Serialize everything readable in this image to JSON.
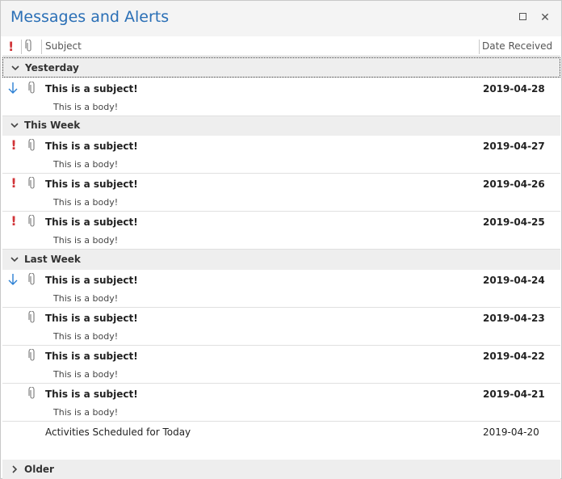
{
  "window": {
    "title": "Messages and Alerts"
  },
  "columns": {
    "importance": "!",
    "subject": "Subject",
    "date": "Date Received"
  },
  "groups": {
    "yesterday": "Yesterday",
    "this_week": "This Week",
    "last_week": "Last Week",
    "older": "Older"
  },
  "rows": [
    {
      "importance": "low",
      "attachment": true,
      "subject": "This is a subject!",
      "body": "This is a body!",
      "date": "2019-04-28"
    },
    {
      "importance": "high",
      "attachment": true,
      "subject": "This is a subject!",
      "body": "This is a body!",
      "date": "2019-04-27"
    },
    {
      "importance": "high",
      "attachment": true,
      "subject": "This is a subject!",
      "body": "This is a body!",
      "date": "2019-04-26"
    },
    {
      "importance": "high",
      "attachment": true,
      "subject": "This is a subject!",
      "body": "This is a body!",
      "date": "2019-04-25"
    },
    {
      "importance": "low",
      "attachment": true,
      "subject": "This is a subject!",
      "body": "This is a body!",
      "date": "2019-04-24"
    },
    {
      "importance": "normal",
      "attachment": true,
      "subject": "This is a subject!",
      "body": "This is a body!",
      "date": "2019-04-23"
    },
    {
      "importance": "normal",
      "attachment": true,
      "subject": "This is a subject!",
      "body": "This is a body!",
      "date": "2019-04-22"
    },
    {
      "importance": "normal",
      "attachment": true,
      "subject": "This is a subject!",
      "body": "This is a body!",
      "date": "2019-04-21"
    },
    {
      "importance": "normal",
      "attachment": false,
      "subject": "Activities Scheduled for Today",
      "body": "",
      "date": "2019-04-20"
    }
  ],
  "colors": {
    "title": "#2a6fb6",
    "high": "#d13438",
    "low": "#2a7fd4",
    "group_bg": "#eeeeee"
  }
}
